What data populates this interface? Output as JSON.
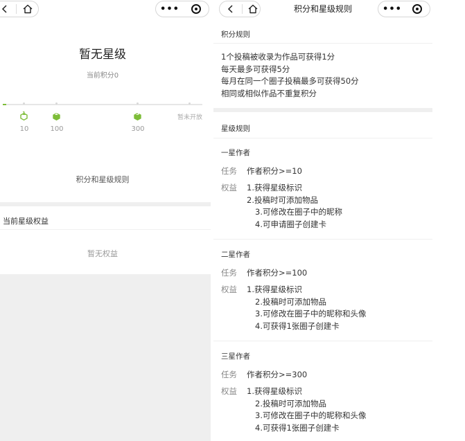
{
  "left": {
    "star_title": "暂无星级",
    "points_text": "当前积分0",
    "progress": {
      "current": 0,
      "levels": [
        {
          "num": "1",
          "value": "10"
        },
        {
          "num": "2",
          "value": "100"
        },
        {
          "num": "3",
          "value": "300"
        }
      ],
      "closed_label": "暂未开放"
    },
    "rules_link": "积分和星级规则",
    "benefit_title": "当前星级权益",
    "no_benefit": "暂无权益"
  },
  "right": {
    "nav_title": "积分和星级规则",
    "points_rules_title": "积分规则",
    "points_rules": [
      "1个投稿被收录为作品可获得1分",
      "每天最多可获得5分",
      "每月在同一个圈子投稿最多可获得50分",
      "相同或相似作品不重复积分"
    ],
    "star_rules_title": "星级规则",
    "task_label": "任务",
    "rights_label": "权益",
    "stars": [
      {
        "name": "一星作者",
        "task": "作者积分>=10",
        "rights": [
          "1.获得星级标识",
          "2.投稿时可添加物品",
          "3.可修改在圈子中的昵称",
          "4.可申请圈子创建卡"
        ]
      },
      {
        "name": "二星作者",
        "task": "作者积分>=100",
        "rights": [
          "1.获得星级标识",
          "2.投稿时可添加物品",
          "3.可修改在圈子中的昵称和头像",
          "4.可获得1张圈子创建卡"
        ]
      },
      {
        "name": "三星作者",
        "task": "作者积分>=300",
        "rights": [
          "1.获得星级标识",
          "2.投稿时可添加物品",
          "3.可修改在圈子中的昵称和头像",
          "4.可获得1张圈子创建卡"
        ]
      }
    ]
  },
  "colors": {
    "accent": "#7dbd38",
    "divider": "#efefef",
    "muted": "#888888"
  }
}
